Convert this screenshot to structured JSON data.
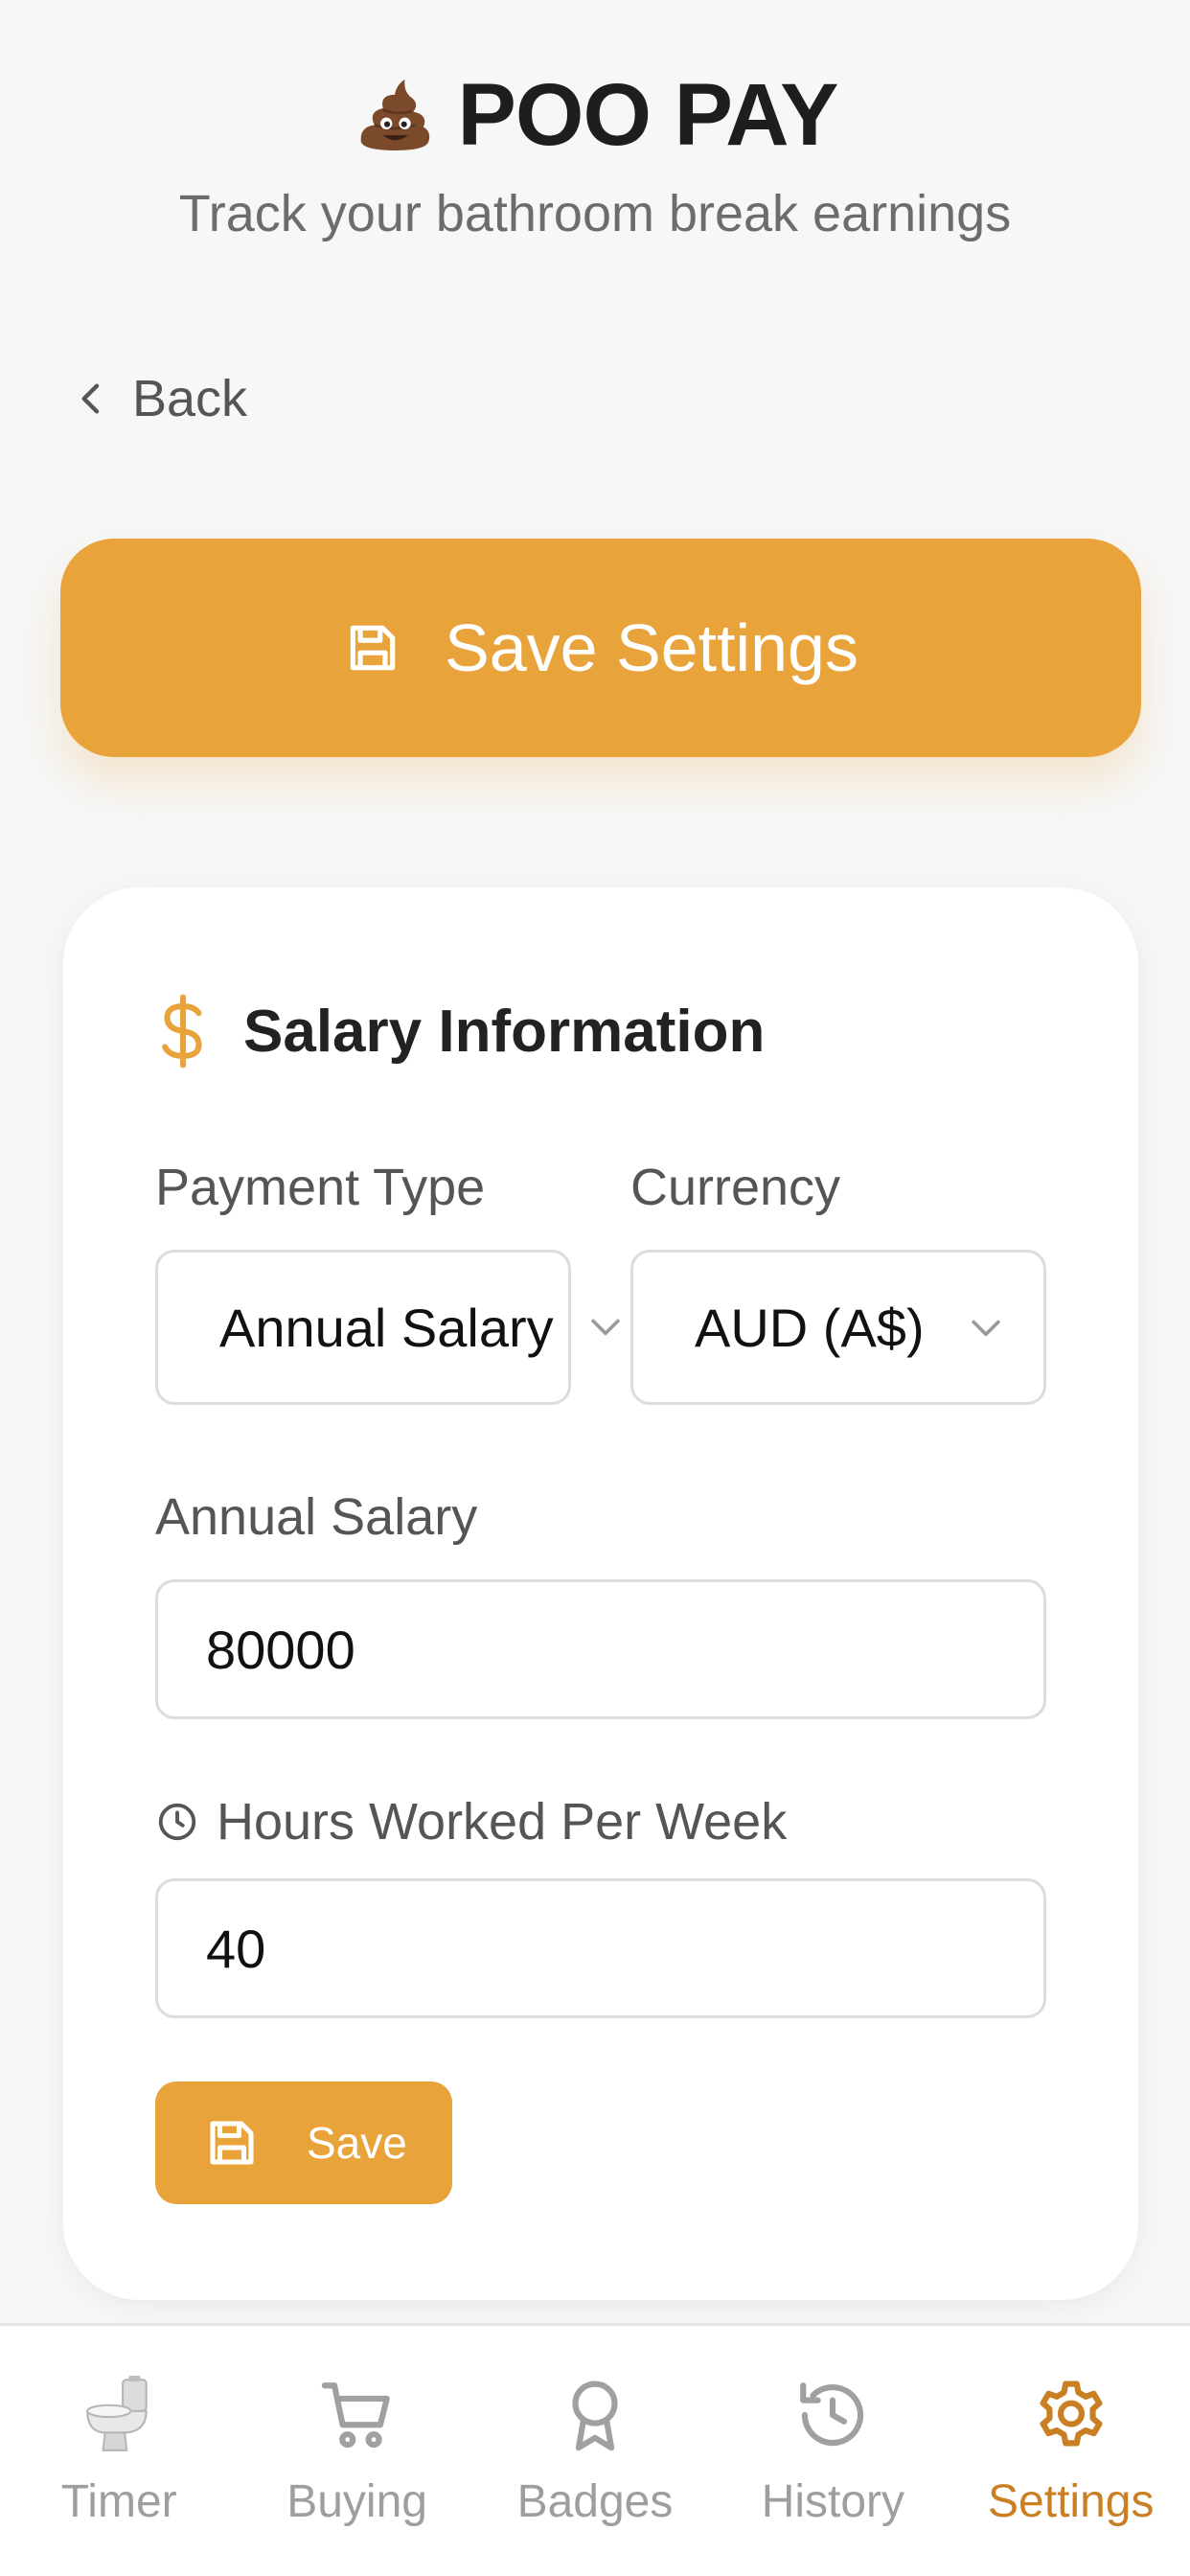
{
  "header": {
    "title": "POO PAY",
    "subtitle": "Track your bathroom break earnings",
    "logo_icon": "poop-emoji-icon"
  },
  "nav": {
    "back_label": "Back"
  },
  "actions": {
    "save_settings_label": "Save Settings"
  },
  "salary_card": {
    "title": "Salary Information",
    "payment_type": {
      "label": "Payment Type",
      "value": "Annual Salary"
    },
    "currency": {
      "label": "Currency",
      "value": "AUD (A$)"
    },
    "annual_salary": {
      "label": "Annual Salary",
      "value": "80000"
    },
    "hours": {
      "label": "Hours Worked Per Week",
      "value": "40"
    },
    "save_label": "Save"
  },
  "tabs": [
    {
      "label": "Timer",
      "icon": "toilet-icon",
      "active": false
    },
    {
      "label": "Buying",
      "icon": "cart-icon",
      "active": false
    },
    {
      "label": "Badges",
      "icon": "award-icon",
      "active": false
    },
    {
      "label": "History",
      "icon": "history-icon",
      "active": false
    },
    {
      "label": "Settings",
      "icon": "gear-icon",
      "active": true
    }
  ],
  "colors": {
    "accent": "#e9a33b",
    "active_tab": "#c97f22",
    "background": "#f7f7f7",
    "card": "#ffffff"
  }
}
